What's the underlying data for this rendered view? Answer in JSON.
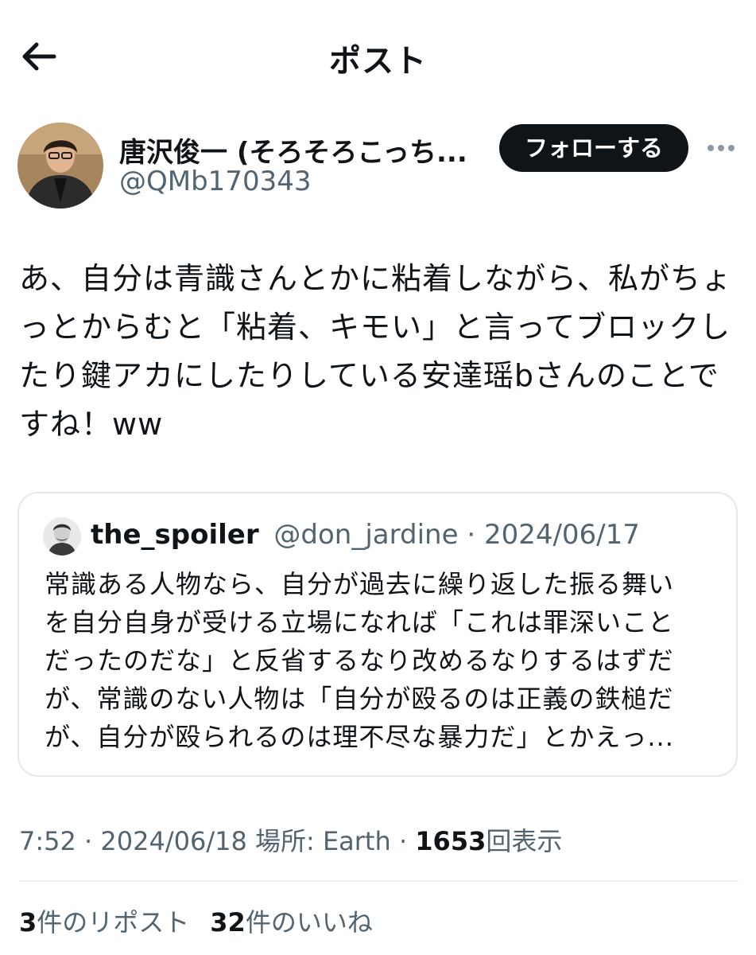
{
  "header": {
    "back_icon": "arrow-left-icon",
    "title": "ポスト"
  },
  "author": {
    "display_name": "唐沢俊一 (そろそろこっち...",
    "handle": "@QMb170343",
    "follow_label": "フォローする",
    "more_icon": "more-horizontal-icon"
  },
  "post": {
    "lines": [
      "あ、自分は青識さんとかに粘着しながら、私がちょ",
      "っとからむと「粘着、キモい」と言ってブロックし",
      "たり鍵アカにしたりしている安達瑶bさんのことで",
      "すね！ww"
    ]
  },
  "quote": {
    "name": "the_spoiler",
    "handle": "@don_jardine",
    "separator": "·",
    "date": "2024/06/17",
    "lines": [
      "常識ある人物なら、自分が過去に繰り返した振る舞い",
      "を自分自身が受ける立場になれば「これは罪深いこと",
      "だったのだな」と反省するなり改めるなりするはずだ",
      "が、常識のない人物は「自分が殴るのは正義の鉄槌だ",
      "が、自分が殴られるのは理不尽な暴力だ」とかえっ..."
    ]
  },
  "meta": {
    "time": "7:52",
    "sep1": "·",
    "date": "2024/06/18",
    "location": "場所: Earth",
    "sep2": "·",
    "views": "1653",
    "views_label": "回表示"
  },
  "stats": {
    "reposts_count": "3",
    "reposts_label": "件のリポスト",
    "likes_count": "32",
    "likes_label": "件のいいね"
  },
  "colors": {
    "text": "#0f1419",
    "secondary": "#536471",
    "border": "#e3e8ec",
    "button": "#0f1419"
  }
}
